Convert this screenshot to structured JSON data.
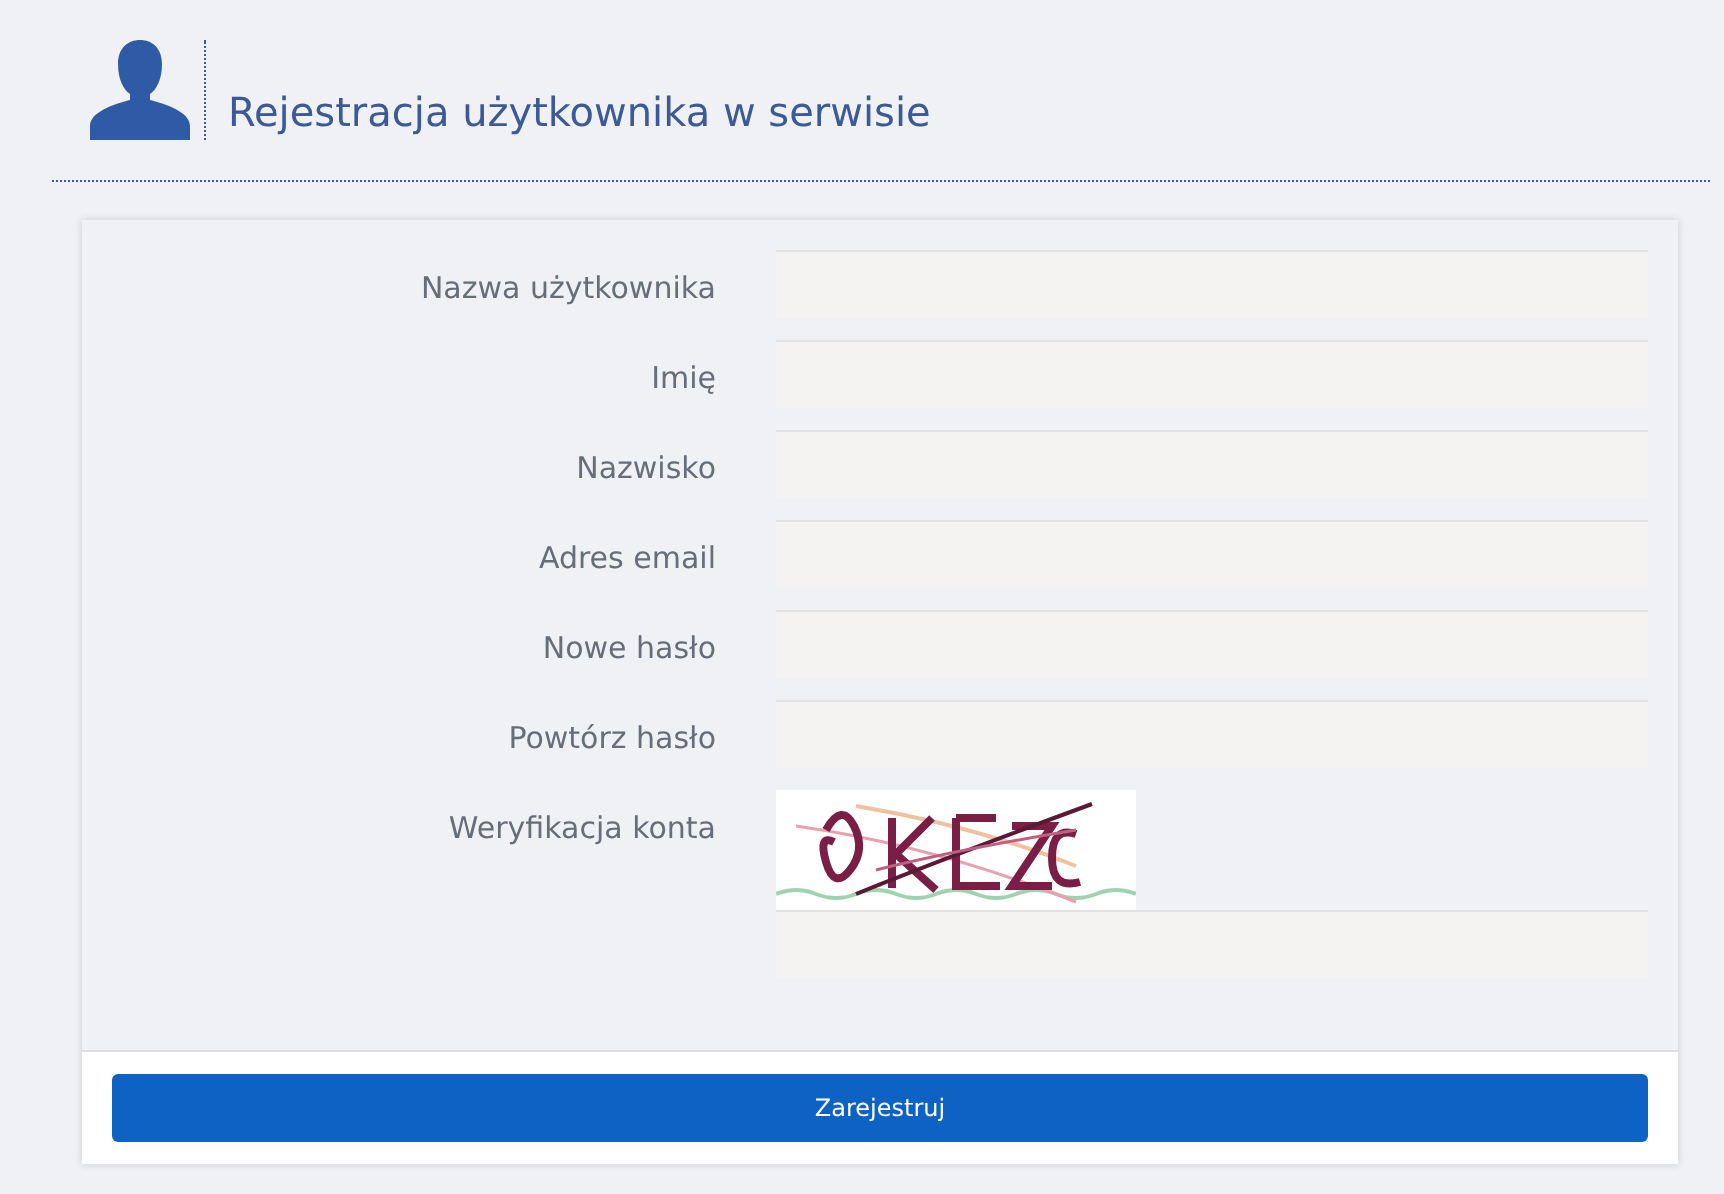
{
  "header": {
    "title": "Rejestracja użytkownika w serwisie"
  },
  "fields": [
    {
      "label": "Nazwa użytkownika",
      "kind": "text"
    },
    {
      "label": "Imię",
      "kind": "text"
    },
    {
      "label": "Nazwisko",
      "kind": "text"
    },
    {
      "label": "Adres email",
      "kind": "text"
    },
    {
      "label": "Nowe hasło",
      "kind": "password"
    },
    {
      "label": "Powtórz hasło",
      "kind": "password"
    },
    {
      "label": "Weryfikacja konta",
      "kind": "captcha"
    }
  ],
  "submit": {
    "label": "Zarejestruj"
  }
}
